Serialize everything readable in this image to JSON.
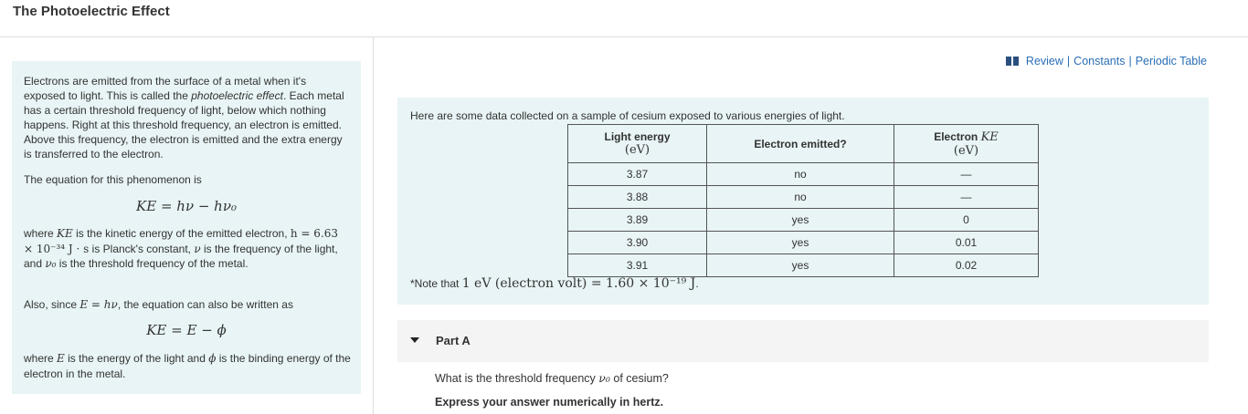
{
  "page": {
    "title": "The Photoelectric Effect"
  },
  "links": {
    "review": "Review",
    "constants": "Constants",
    "periodic_table": "Periodic Table",
    "separator": "|"
  },
  "intro": {
    "para1_a": "Electrons are emitted from the surface of a metal when it's exposed to light. This is called the ",
    "para1_em": "photoelectric effect",
    "para1_b": ". Each metal has a certain threshold frequency of light, below which nothing happens. Right at this threshold frequency, an electron is emitted. Above this frequency, the electron is emitted and the extra energy is transferred to the electron.",
    "eq_intro": "The equation for this phenomenon is",
    "equation1": "KE = hν − hν₀",
    "where1_a": "where ",
    "where1_ke": "KE",
    "where1_b": " is the kinetic energy of the emitted electron, ",
    "where1_h": "h = 6.63 × 10⁻³⁴ J · s",
    "where1_c": " is Planck's constant, ",
    "where1_nu": "ν",
    "where1_d": " is the frequency of the light, and ",
    "where1_nu0": "ν₀",
    "where1_e": " is the threshold frequency of the metal.",
    "also_a": "Also, since ",
    "also_eq": "E = hν",
    "also_b": ", the equation can also be written as",
    "equation2": "KE = E − ϕ",
    "where2_a": "where ",
    "where2_e": "E",
    "where2_b": " is the energy of the light and ",
    "where2_phi": "ϕ",
    "where2_c": " is the binding energy of the electron in the metal."
  },
  "data_panel": {
    "intro": "Here are some data collected on a sample of cesium exposed to various energies of light.",
    "headers": {
      "col1_title": "Light energy",
      "col1_unit": "(eV)",
      "col2_title": "Electron emitted?",
      "col3_title_a": "Electron ",
      "col3_title_b": "KE",
      "col3_unit": "(eV)"
    },
    "rows": [
      {
        "energy": "3.87",
        "emitted": "no",
        "ke": "—"
      },
      {
        "energy": "3.88",
        "emitted": "no",
        "ke": "—"
      },
      {
        "energy": "3.89",
        "emitted": "yes",
        "ke": "0"
      },
      {
        "energy": "3.90",
        "emitted": "yes",
        "ke": "0.01"
      },
      {
        "energy": "3.91",
        "emitted": "yes",
        "ke": "0.02"
      }
    ],
    "note_a": "*Note that ",
    "note_eq": "1 eV (electron volt) = 1.60 × 10⁻¹⁹ J",
    "note_b": "."
  },
  "part_a": {
    "label": "Part A",
    "question_a": "What is the threshold frequency ",
    "question_nu0": "ν₀",
    "question_b": " of cesium?",
    "instruction": "Express your answer numerically in hertz."
  }
}
